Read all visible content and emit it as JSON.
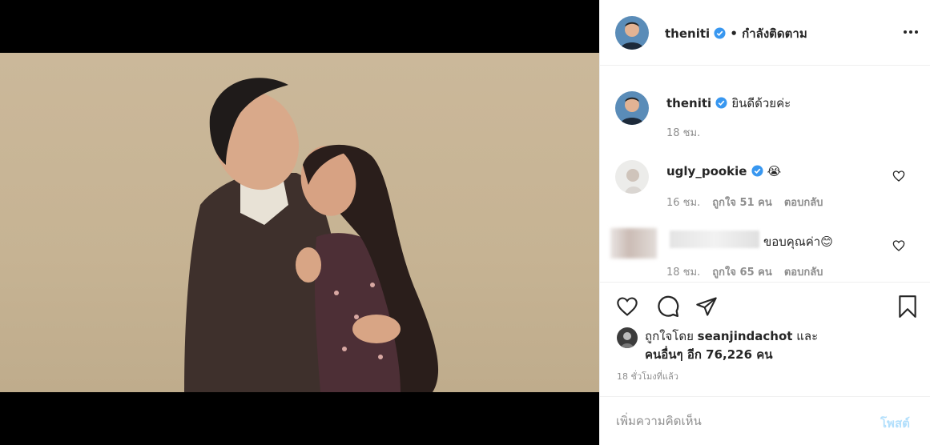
{
  "post_author": {
    "username": "theniti",
    "follow_status": "• กำลังติดตาม",
    "more_icon": "more-horizontal-icon"
  },
  "caption": {
    "username": "theniti",
    "text": "ยินดีด้วยค่ะ",
    "time": "18 ชม."
  },
  "comments": [
    {
      "username": "ugly_pookie",
      "text": "😭",
      "time": "16 ชม.",
      "likes": "ถูกใจ 51 คน",
      "reply": "ตอบกลับ"
    },
    {
      "username": "",
      "text": "ขอบคุณค่า😊",
      "time": "18 ชม.",
      "likes": "ถูกใจ 65 คน",
      "reply": "ตอบกลับ"
    }
  ],
  "liked_by": {
    "prefix": "ถูกใจโดย",
    "user": "seanjindachot",
    "and": "และ",
    "others": "คนอื่นๆ อีก 76,226 คน"
  },
  "post_time": "18 ชั่วโมงที่แล้ว",
  "add_comment": {
    "placeholder": "เพิ่มความคิดเห็น",
    "post_label": "โพสต์"
  },
  "colors": {
    "verified": "#3897f0",
    "link_disabled": "#b2dffc",
    "muted": "#8e8e8e",
    "text": "#262626"
  }
}
